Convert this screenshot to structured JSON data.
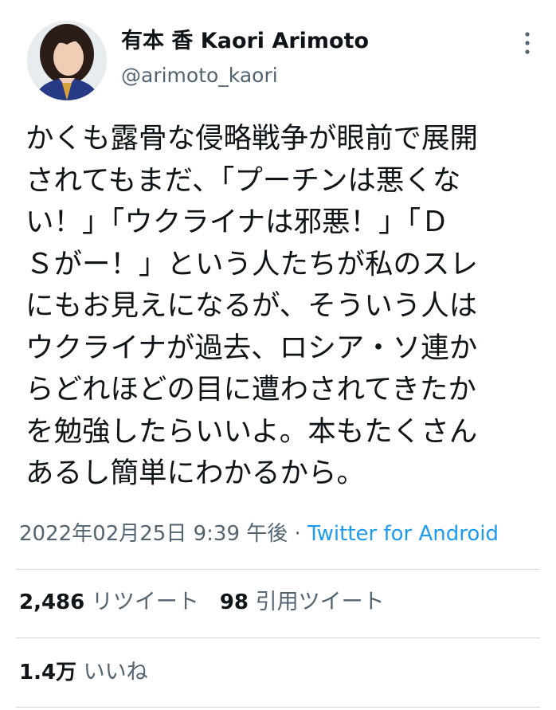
{
  "author": {
    "display_name": "有本 香 Kaori Arimoto",
    "handle": "@arimoto_kaori"
  },
  "tweet": {
    "lines": [
      "かくも露骨な侵略戦争が眼前で展開",
      "されてもまだ、「プーチンは悪くな",
      "い！」「ウクライナは邪悪！」「Ｄ",
      "Ｓがー！」という人たちが私のスレ",
      "にもお見えになるが、そういう人は",
      "ウクライナが過去、ロシア・ソ連か",
      "らどれほどの目に遭わされてきたか",
      "を勉強したらいいよ。本もたくさん",
      "あるし簡単にわかるから。"
    ],
    "timestamp": "2022年02月25日 9:39 午後",
    "separator": " · ",
    "source": "Twitter for Android"
  },
  "stats": {
    "retweets_count": "2,486",
    "retweets_label": "リツイート",
    "quotes_count": "98",
    "quotes_label": "引用ツイート",
    "likes_count": "1.4万",
    "likes_label": "いいね"
  },
  "icons": {
    "more": "more-vertical-icon",
    "avatar": "avatar"
  },
  "colors": {
    "text_primary": "#0f1419",
    "text_secondary": "#536471",
    "link": "#1d9bf0",
    "divider": "#cfd9de"
  }
}
